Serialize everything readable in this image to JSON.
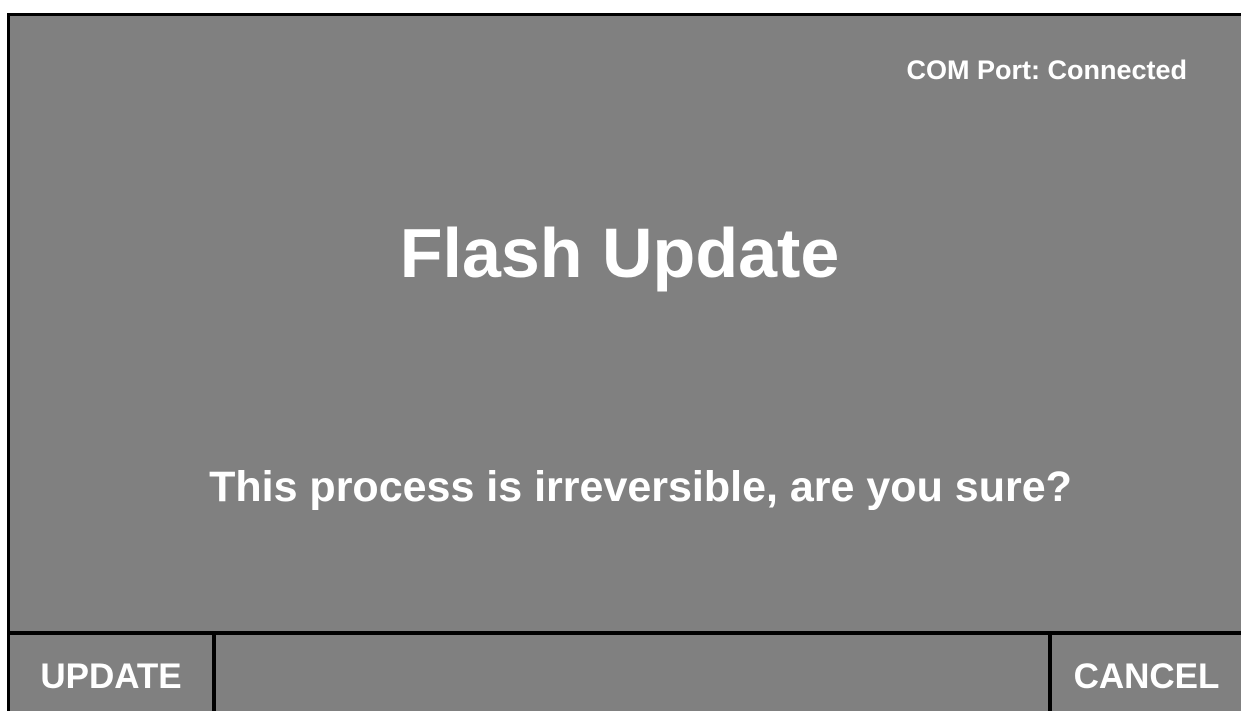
{
  "colors": {
    "background": "#808080",
    "text": "#ffffff",
    "border": "#000000"
  },
  "status": {
    "com_port": "COM Port: Connected"
  },
  "dialog": {
    "title": "Flash Update",
    "prompt": "This process is irreversible, are you sure?"
  },
  "softkeys": {
    "left_label": "UPDATE",
    "right_label": "CANCEL"
  }
}
